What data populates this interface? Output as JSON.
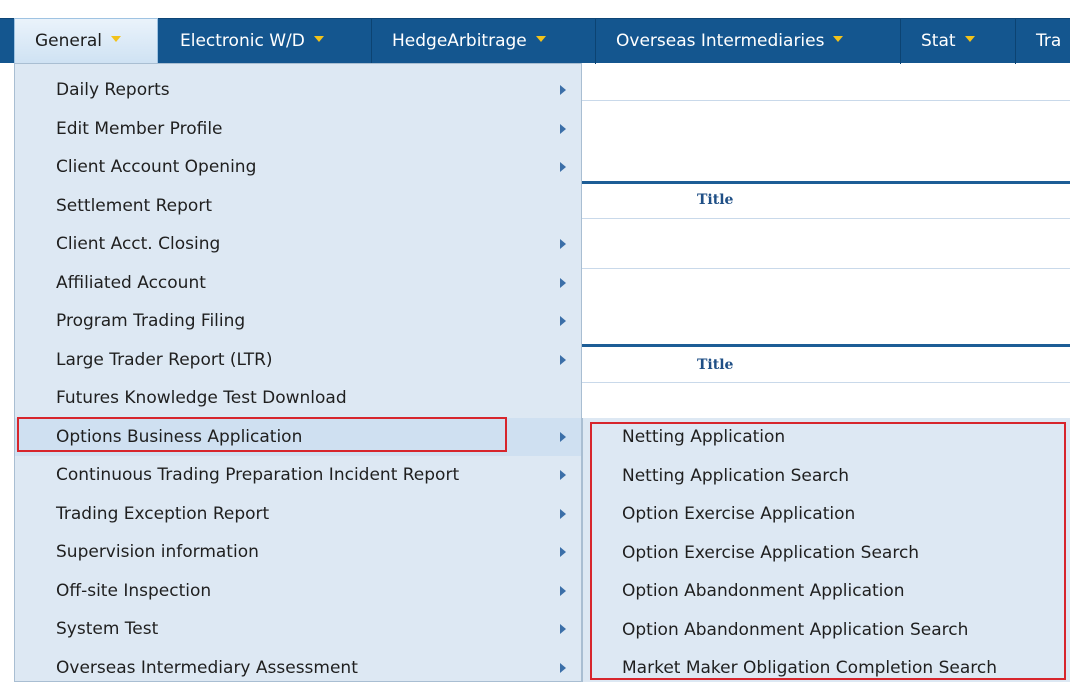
{
  "nav": {
    "items": [
      {
        "label": "General"
      },
      {
        "label": "Electronic W/D"
      },
      {
        "label": "HedgeArbitrage"
      },
      {
        "label": "Overseas Intermediaries"
      },
      {
        "label": "Stat"
      },
      {
        "label": "Tra"
      }
    ]
  },
  "background": {
    "title_1": "Title",
    "title_2": "Title"
  },
  "menu": {
    "items": [
      {
        "label": "Daily Reports",
        "submenu": true
      },
      {
        "label": "Edit Member Profile",
        "submenu": true
      },
      {
        "label": "Client Account Opening",
        "submenu": true
      },
      {
        "label": "Settlement Report",
        "submenu": false
      },
      {
        "label": "Client Acct. Closing",
        "submenu": true
      },
      {
        "label": "Affiliated Account",
        "submenu": true
      },
      {
        "label": "Program Trading Filing",
        "submenu": true
      },
      {
        "label": "Large Trader Report (LTR)",
        "submenu": true
      },
      {
        "label": "Futures Knowledge Test Download",
        "submenu": false
      },
      {
        "label": "Options Business Application",
        "submenu": true,
        "highlighted": true
      },
      {
        "label": "Continuous Trading Preparation Incident Report",
        "submenu": true
      },
      {
        "label": "Trading Exception Report",
        "submenu": true
      },
      {
        "label": "Supervision information",
        "submenu": true
      },
      {
        "label": "Off-site Inspection",
        "submenu": true
      },
      {
        "label": "System Test",
        "submenu": true
      },
      {
        "label": "Overseas Intermediary Assessment",
        "submenu": true
      }
    ]
  },
  "submenu": {
    "items": [
      {
        "label": "Netting Application"
      },
      {
        "label": "Netting Application Search"
      },
      {
        "label": "Option Exercise Application"
      },
      {
        "label": "Option Exercise Application Search"
      },
      {
        "label": "Option Abandonment Application"
      },
      {
        "label": "Option Abandonment Application Search"
      },
      {
        "label": "Market Maker Obligation Completion Search"
      }
    ]
  },
  "colors": {
    "nav_bg": "#14568f",
    "menu_bg": "#dde8f3",
    "highlight_border": "#d7252c",
    "caret": "#f2c21a"
  }
}
